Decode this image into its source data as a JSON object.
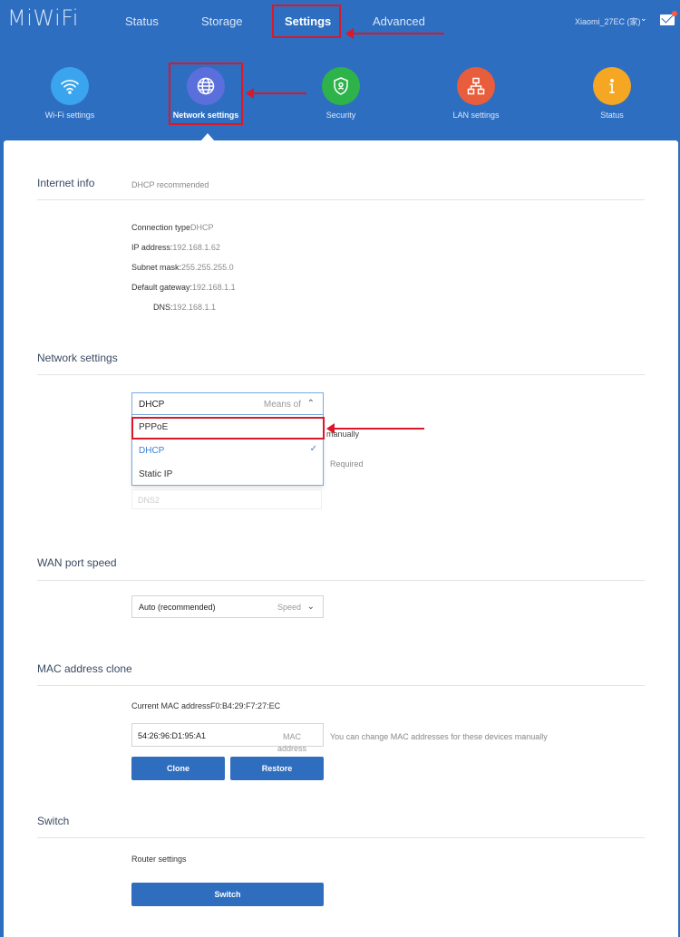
{
  "header": {
    "logo": "MiWiFi",
    "nav": [
      "Status",
      "Storage",
      "Settings",
      "Advanced"
    ],
    "active_nav": "Settings",
    "ssid": "Xiaomi_27EC (家)",
    "chevron": "⌄"
  },
  "settings_nav": [
    {
      "label": "Wi-Fi settings",
      "icon": "wifi-icon",
      "color": "#3aa4ee"
    },
    {
      "label": "Network settings",
      "icon": "globe-icon",
      "color": "#5b6fdc"
    },
    {
      "label": "Security",
      "icon": "shield-icon",
      "color": "#2db34a"
    },
    {
      "label": "LAN settings",
      "icon": "network-icon",
      "color": "#e85d3b"
    },
    {
      "label": "Status",
      "icon": "info-icon",
      "color": "#f5a623"
    }
  ],
  "internet_info": {
    "title": "Internet info",
    "note": "DHCP recommended",
    "connection_type_label": "Connection type",
    "connection_type": "DHCP",
    "ip_label": "IP address:",
    "ip": "192.168.1.62",
    "subnet_label": "Subnet mask:",
    "subnet": "255.255.255.0",
    "gateway_label": "Default gateway:",
    "gateway": "192.168.1.1",
    "dns_label": "DNS:",
    "dns": "192.168.1.1"
  },
  "network_settings": {
    "title": "Network settings",
    "select_value": "DHCP",
    "select_hint": "Means of",
    "options": [
      "PPPoE",
      "DHCP",
      "Static IP"
    ],
    "selected": "DHCP",
    "side_text_1": "manually",
    "side_text_2": "Required",
    "faded_field": "DNS2"
  },
  "wan": {
    "title": "WAN port speed",
    "select_value": "Auto (recommended)",
    "select_hint": "Speed"
  },
  "mac": {
    "title": "MAC address clone",
    "current_label": "Current MAC address",
    "current_value": "F0:B4:29:F7:27:EC",
    "input_value": "54:26:96:D1:95:A1",
    "input_tag": "MAC address",
    "help": "You can change MAC addresses for these devices manually",
    "clone_label": "Clone",
    "restore_label": "Restore"
  },
  "switch": {
    "title": "Switch",
    "router_label": "Router settings",
    "button_label": "Switch"
  },
  "colors": {
    "brand": "#2e6ec0",
    "highlight": "#d9182a",
    "button": "#2f6ebf"
  }
}
